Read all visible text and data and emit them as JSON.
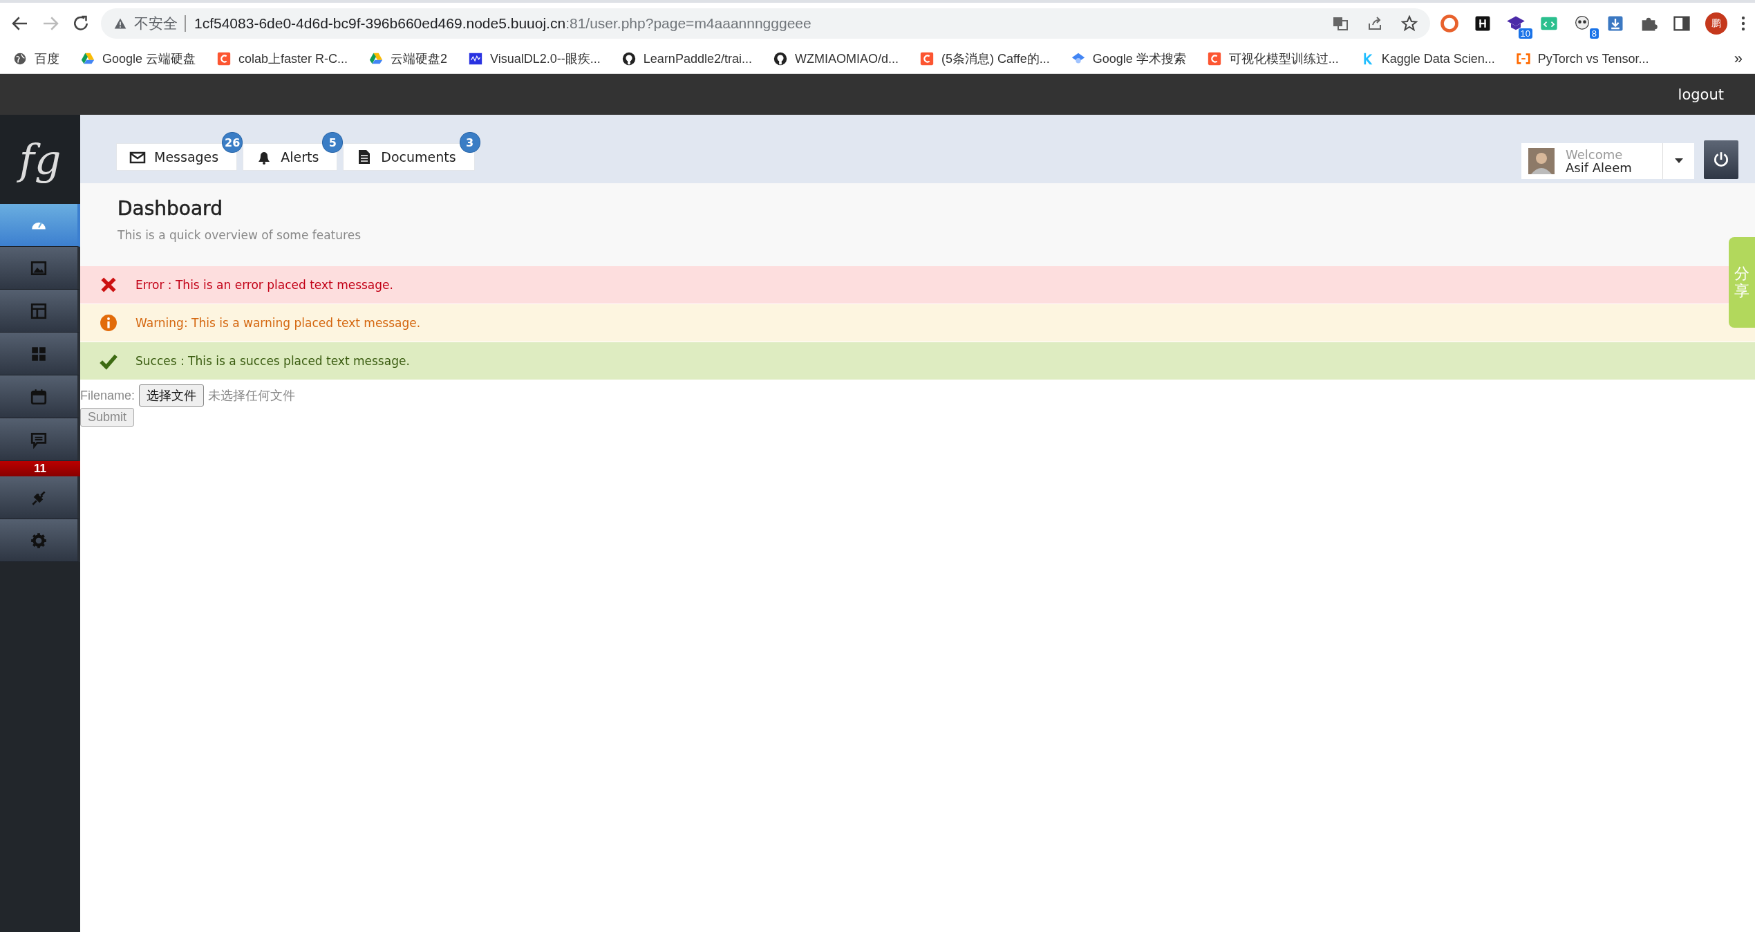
{
  "browser": {
    "security_label": "不安全",
    "url_host": "1cf54083-6de0-4d6d-bc9f-396b660ed469.node5.buuoj.cn",
    "url_path": ":81/user.php?page=m4aaannngggeee",
    "extensions": [
      {
        "kind": "record"
      },
      {
        "kind": "h"
      },
      {
        "kind": "cap",
        "badge": "10"
      },
      {
        "kind": "code"
      },
      {
        "kind": "panda",
        "badge": "8"
      },
      {
        "kind": "download"
      },
      {
        "kind": "puzzle"
      },
      {
        "kind": "panel"
      }
    ],
    "profile_initial": "鹏",
    "bookmarks": [
      {
        "label": "百度",
        "kind": "globe"
      },
      {
        "label": "Google 云端硬盘",
        "kind": "drive"
      },
      {
        "label": "colab上faster R-C...",
        "kind": "csdn"
      },
      {
        "label": "云端硬盘2",
        "kind": "drive"
      },
      {
        "label": "VisualDL2.0--眼疾...",
        "kind": "visualdl"
      },
      {
        "label": "LearnPaddle2/trai...",
        "kind": "github"
      },
      {
        "label": "WZMIAOMIAO/d...",
        "kind": "github"
      },
      {
        "label": "(5条消息) Caffe的...",
        "kind": "csdn"
      },
      {
        "label": "Google 学术搜索",
        "kind": "scholar"
      },
      {
        "label": "可视化模型训练过...",
        "kind": "csdn"
      },
      {
        "label": "Kaggle Data Scien...",
        "kind": "kaggle"
      },
      {
        "label": "PyTorch vs Tensor...",
        "kind": "aliyun"
      }
    ],
    "more": "»"
  },
  "top_bar": {
    "logout": "logout"
  },
  "sidebar": {
    "logo": "fg",
    "items": [
      {
        "kind": "dashboard",
        "selected": true
      },
      {
        "kind": "image",
        "selected": false
      },
      {
        "kind": "layout",
        "selected": false
      },
      {
        "kind": "grid",
        "selected": false
      },
      {
        "kind": "calendar",
        "selected": false
      },
      {
        "kind": "chat",
        "selected": false,
        "badge": "11"
      },
      {
        "kind": "plug",
        "selected": false
      },
      {
        "kind": "settings",
        "selected": false
      }
    ]
  },
  "header_tabs": [
    {
      "label": "Messages",
      "count": "26",
      "kind": "mail"
    },
    {
      "label": "Alerts",
      "count": "5",
      "kind": "bell"
    },
    {
      "label": "Documents",
      "count": "3",
      "kind": "document"
    }
  ],
  "user": {
    "greeting": "Welcome",
    "name": "Asif Aleem"
  },
  "page": {
    "title": "Dashboard",
    "subtitle": "This is a quick overview of some features"
  },
  "alerts": [
    {
      "kind": "error",
      "text": "Error : This is an error placed text message."
    },
    {
      "kind": "warning",
      "text": "Warning: This is a warning placed text message."
    },
    {
      "kind": "success",
      "text": "Succes : This is a succes placed text message."
    }
  ],
  "form": {
    "label": "Filename:",
    "choose_button": "选择文件",
    "file_status": "未选择任何文件",
    "submit": "Submit"
  },
  "share_tab": {
    "text": "分享"
  }
}
